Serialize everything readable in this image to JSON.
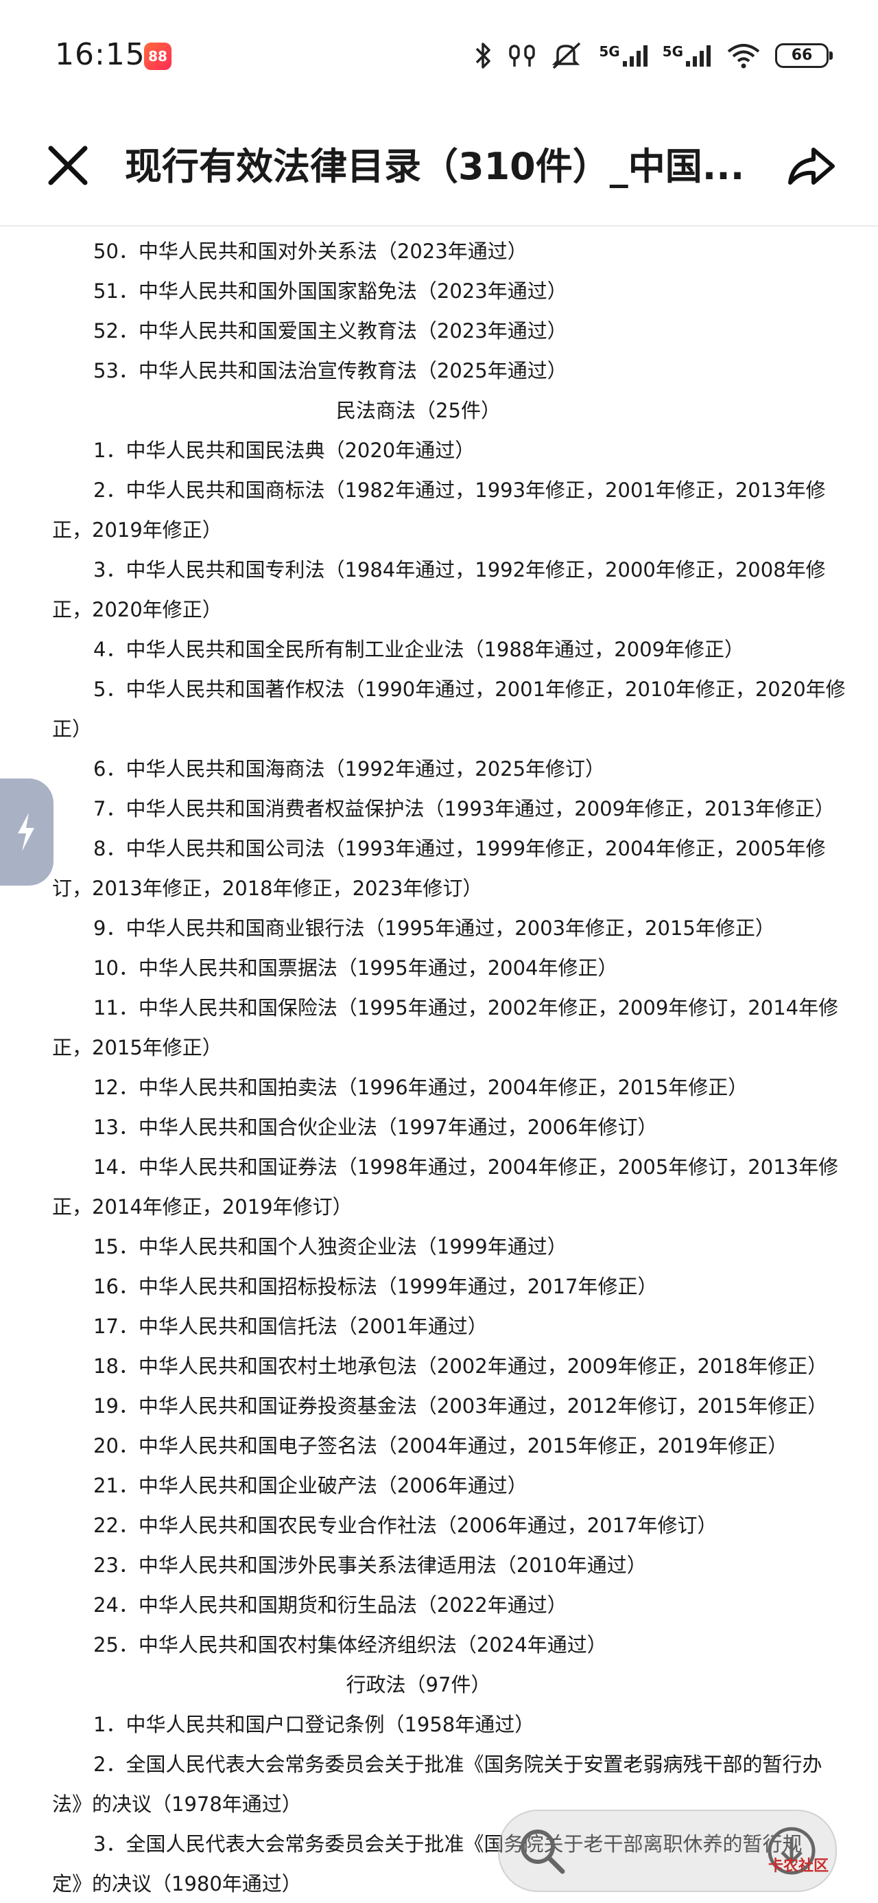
{
  "status_bar": {
    "time": "16:15",
    "app_badge": "88",
    "signal1_label": "5G",
    "signal2_label": "5G",
    "battery": "66"
  },
  "header": {
    "title": "现行有效法律目录（310件）_中国..."
  },
  "content": {
    "lines": [
      "50．中华人民共和国对外关系法（2023年通过）",
      "51．中华人民共和国外国国家豁免法（2023年通过）",
      "52．中华人民共和国爱国主义教育法（2023年通过）",
      "53．中华人民共和国法治宣传教育法（2025年通过）",
      "民法商法（25件）",
      "1．中华人民共和国民法典（2020年通过）",
      "2．中华人民共和国商标法（1982年通过，1993年修正，2001年修正，2013年修",
      "正，2019年修正）",
      "3．中华人民共和国专利法（1984年通过，1992年修正，2000年修正，2008年修",
      "正，2020年修正）",
      "4．中华人民共和国全民所有制工业企业法（1988年通过，2009年修正）",
      "5．中华人民共和国著作权法（1990年通过，2001年修正，2010年修正，2020年修",
      "正）",
      "6．中华人民共和国海商法（1992年通过，2025年修订）",
      "7．中华人民共和国消费者权益保护法（1993年通过，2009年修正，2013年修正）",
      "8．中华人民共和国公司法（1993年通过，1999年修正，2004年修正，2005年修",
      "订，2013年修正，2018年修正，2023年修订）",
      "9．中华人民共和国商业银行法（1995年通过，2003年修正，2015年修正）",
      "10．中华人民共和国票据法（1995年通过，2004年修正）",
      "11．中华人民共和国保险法（1995年通过，2002年修正，2009年修订，2014年修",
      "正，2015年修正）",
      "12．中华人民共和国拍卖法（1996年通过，2004年修正，2015年修正）",
      "13．中华人民共和国合伙企业法（1997年通过，2006年修订）",
      "14．中华人民共和国证券法（1998年通过，2004年修正，2005年修订，2013年修",
      "正，2014年修正，2019年修订）",
      "15．中华人民共和国个人独资企业法（1999年通过）",
      "16．中华人民共和国招标投标法（1999年通过，2017年修正）",
      "17．中华人民共和国信托法（2001年通过）",
      "18．中华人民共和国农村土地承包法（2002年通过，2009年修正，2018年修正）",
      "19．中华人民共和国证券投资基金法（2003年通过，2012年修订，2015年修正）",
      "20．中华人民共和国电子签名法（2004年通过，2015年修正，2019年修正）",
      "21．中华人民共和国企业破产法（2006年通过）",
      "22．中华人民共和国农民专业合作社法（2006年通过，2017年修订）",
      "23．中华人民共和国涉外民事关系法律适用法（2010年通过）",
      "24．中华人民共和国期货和衍生品法（2022年通过）",
      "25．中华人民共和国农村集体经济组织法（2024年通过）",
      "行政法（97件）",
      "1．中华人民共和国户口登记条例（1958年通过）",
      "2．全国人民代表大会常务委员会关于批准《国务院关于安置老弱病残干部的暂行办",
      "法》的决议（1978年通过）",
      "3．全国人民代表大会常务委员会关于批准《国务院关于老干部离职休养的暂行规",
      "定》的决议（1980年通过）"
    ]
  },
  "watermark": "卡农社区"
}
